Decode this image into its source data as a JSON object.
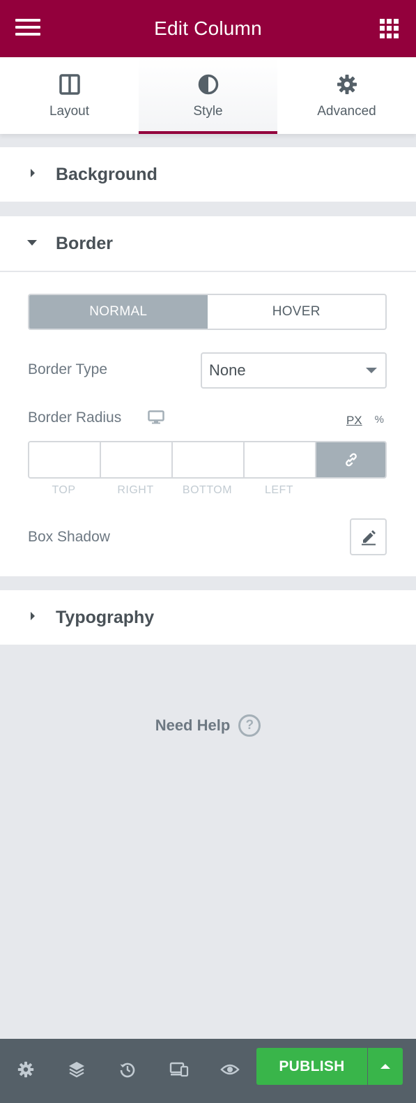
{
  "header": {
    "title": "Edit Column",
    "bg_color": "#93003c"
  },
  "tabs": [
    {
      "label": "Layout",
      "icon": "columns-icon",
      "active": false
    },
    {
      "label": "Style",
      "icon": "contrast-icon",
      "active": true
    },
    {
      "label": "Advanced",
      "icon": "gear-icon",
      "active": false
    }
  ],
  "sections": {
    "background": {
      "title": "Background",
      "expanded": false
    },
    "border": {
      "title": "Border",
      "expanded": true
    },
    "typography": {
      "title": "Typography",
      "expanded": false
    }
  },
  "border_controls": {
    "state_tabs": [
      {
        "label": "NORMAL",
        "active": true
      },
      {
        "label": "HOVER",
        "active": false
      }
    ],
    "border_type": {
      "label": "Border Type",
      "value": "None"
    },
    "border_radius": {
      "label": "Border Radius",
      "units": [
        {
          "label": "PX",
          "active": true
        },
        {
          "label": "%",
          "active": false
        }
      ],
      "dimensions": [
        "TOP",
        "RIGHT",
        "BOTTOM",
        "LEFT"
      ],
      "values": [
        "",
        "",
        "",
        ""
      ]
    },
    "box_shadow": {
      "label": "Box Shadow"
    }
  },
  "help": {
    "label": "Need Help",
    "icon": "question-circle-icon"
  },
  "footer": {
    "icons": [
      "settings-icon",
      "layers-icon",
      "history-icon",
      "responsive-icon",
      "preview-eye-icon"
    ],
    "publish_label": "PUBLISH",
    "publish_color": "#39b54a"
  }
}
